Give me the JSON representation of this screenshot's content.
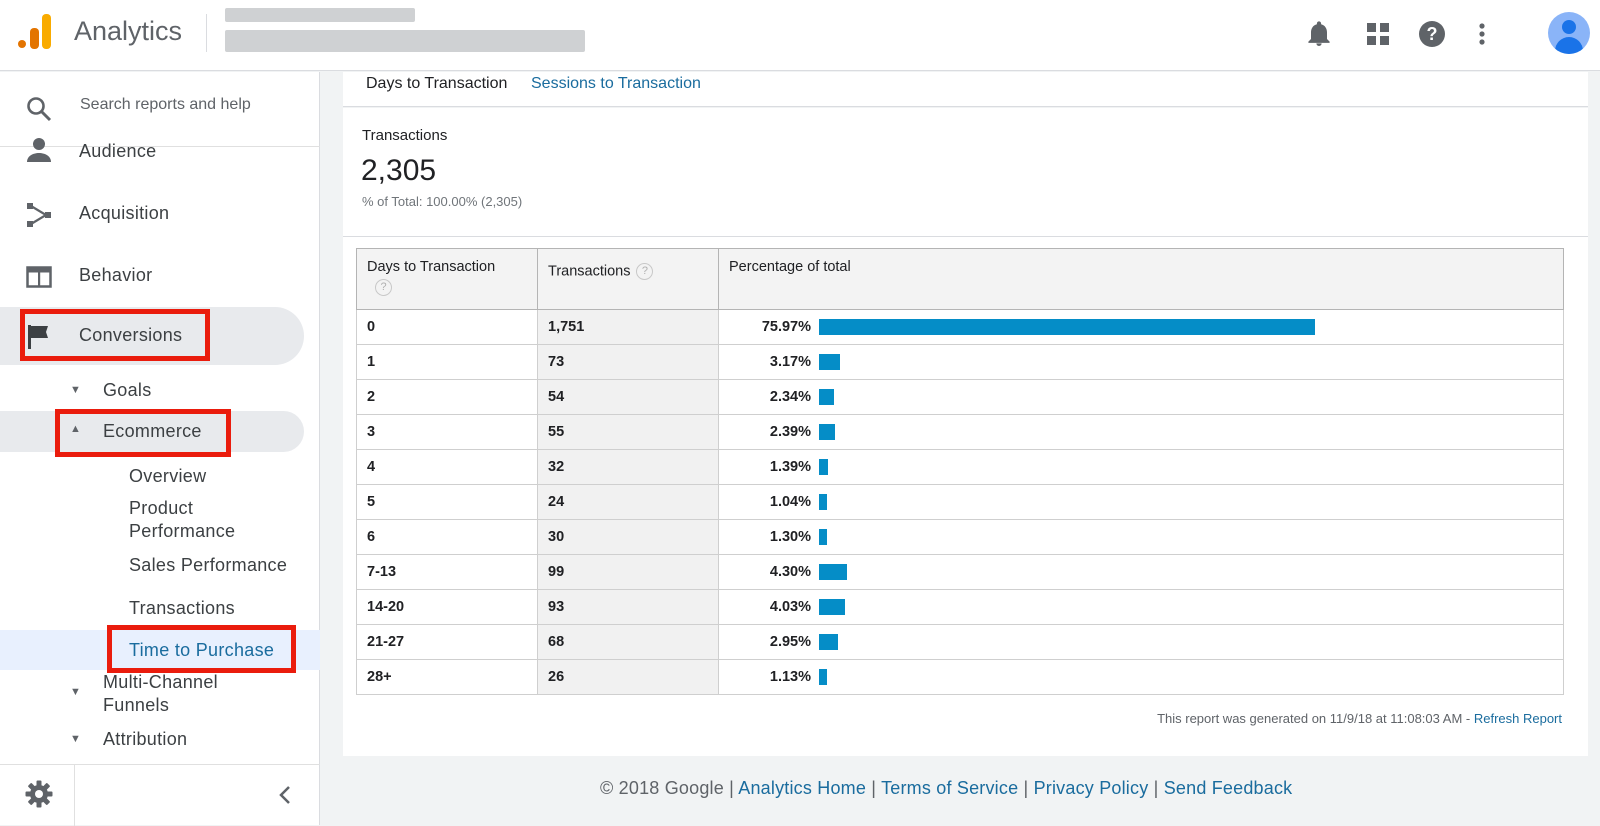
{
  "header": {
    "app_title": "Analytics",
    "icons": [
      "bell-icon",
      "apps-grid-icon",
      "help-icon",
      "more-vert-icon",
      "avatar"
    ]
  },
  "sidebar": {
    "search_placeholder": "Search reports and help",
    "items": [
      {
        "label": "Audience",
        "icon": "person-icon"
      },
      {
        "label": "Acquisition",
        "icon": "acquisition-icon"
      },
      {
        "label": "Behavior",
        "icon": "behavior-icon"
      },
      {
        "label": "Conversions",
        "icon": "flag-icon"
      }
    ],
    "conversions_children": {
      "goals": "Goals",
      "ecommerce": "Ecommerce",
      "ecommerce_children": [
        "Overview",
        "Product Performance",
        "Sales Performance",
        "Transactions",
        "Time to Purchase"
      ],
      "multi_channel": "Multi-Channel Funnels",
      "attribution": "Attribution"
    }
  },
  "tabs": {
    "active": "Days to Transaction",
    "other": "Sessions to Transaction"
  },
  "summary": {
    "label": "Transactions",
    "value": "2,305",
    "sub": "% of Total: 100.00% (2,305)"
  },
  "table": {
    "headers": [
      "Days to Transaction",
      "Transactions",
      "Percentage of total"
    ],
    "rows": [
      {
        "days": "0",
        "transactions": "1,751",
        "pct": "75.97%",
        "share": 75.97
      },
      {
        "days": "1",
        "transactions": "73",
        "pct": "3.17%",
        "share": 3.17
      },
      {
        "days": "2",
        "transactions": "54",
        "pct": "2.34%",
        "share": 2.34
      },
      {
        "days": "3",
        "transactions": "55",
        "pct": "2.39%",
        "share": 2.39
      },
      {
        "days": "4",
        "transactions": "32",
        "pct": "1.39%",
        "share": 1.39
      },
      {
        "days": "5",
        "transactions": "24",
        "pct": "1.04%",
        "share": 1.04
      },
      {
        "days": "6",
        "transactions": "30",
        "pct": "1.30%",
        "share": 1.3
      },
      {
        "days": "7-13",
        "transactions": "99",
        "pct": "4.30%",
        "share": 4.3
      },
      {
        "days": "14-20",
        "transactions": "93",
        "pct": "4.03%",
        "share": 4.03
      },
      {
        "days": "21-27",
        "transactions": "68",
        "pct": "2.95%",
        "share": 2.95
      },
      {
        "days": "28+",
        "transactions": "26",
        "pct": "1.13%",
        "share": 1.13
      }
    ]
  },
  "report_note": {
    "text": "This report was generated on 11/9/18 at 11:08:03 AM - ",
    "link": "Refresh Report"
  },
  "footer": {
    "copyright": "© 2018 Google",
    "links": [
      "Analytics Home",
      "Terms of Service",
      "Privacy Policy",
      "Send Feedback"
    ]
  },
  "colors": {
    "bar": "#058dc7",
    "link": "#1a6c9e",
    "highlight": "#ea1c0d"
  }
}
